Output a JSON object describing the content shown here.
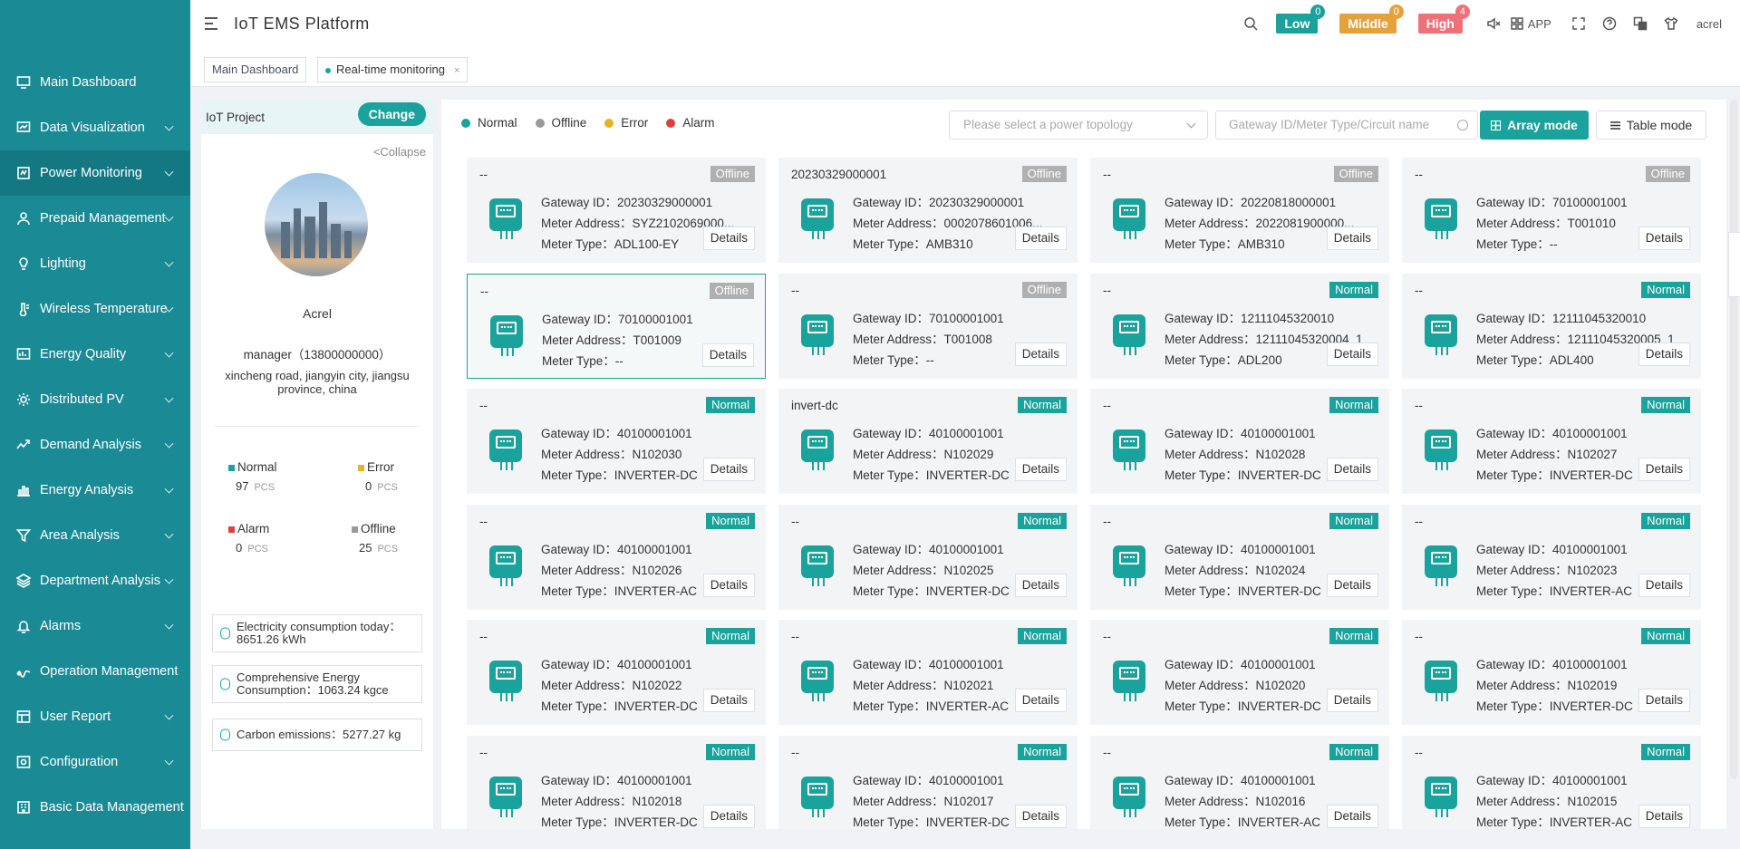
{
  "header": {
    "title": "IoT EMS Platform",
    "alerts": [
      {
        "label": "Low",
        "count": "0",
        "color": "#1aa39c",
        "badge_color": "#1aa39c"
      },
      {
        "label": "Middle",
        "count": "0",
        "color": "#e5a23b",
        "badge_color": "#e5a23b"
      },
      {
        "label": "High",
        "count": "4",
        "color": "#f07077",
        "badge_color": "#f07077"
      }
    ],
    "app_label": "APP",
    "user": "acrel"
  },
  "tabs": [
    {
      "label": "Main Dashboard",
      "active": false
    },
    {
      "label": "Real-time monitoring",
      "active": true,
      "close": "×"
    }
  ],
  "sidebar": {
    "items": [
      {
        "label": "Main Dashboard",
        "icon": "monitor-icon",
        "chevron": false
      },
      {
        "label": "Data Visualization",
        "icon": "screen-icon",
        "chevron": true
      },
      {
        "label": "Power Monitoring",
        "icon": "power-icon",
        "chevron": true,
        "active": true
      },
      {
        "label": "Prepaid Management",
        "icon": "user-icon",
        "chevron": true
      },
      {
        "label": "Lighting",
        "icon": "bulb-icon",
        "chevron": true
      },
      {
        "label": "Wireless Temperature",
        "icon": "thermometer-icon",
        "chevron": true
      },
      {
        "label": "Energy Quality",
        "icon": "quality-icon",
        "chevron": true
      },
      {
        "label": "Distributed PV",
        "icon": "sun-icon",
        "chevron": true
      },
      {
        "label": "Demand Analysis",
        "icon": "trend-icon",
        "chevron": true
      },
      {
        "label": "Energy Analysis",
        "icon": "bar-chart-icon",
        "chevron": true
      },
      {
        "label": "Area Analysis",
        "icon": "filter-icon",
        "chevron": true
      },
      {
        "label": "Department Analysis",
        "icon": "layers-icon",
        "chevron": true
      },
      {
        "label": "Alarms",
        "icon": "bell-icon",
        "chevron": true
      },
      {
        "label": "Operation Management",
        "icon": "wave-icon",
        "chevron": false
      },
      {
        "label": "User Report",
        "icon": "report-icon",
        "chevron": true
      },
      {
        "label": "Configuration",
        "icon": "config-icon",
        "chevron": true
      },
      {
        "label": "Basic Data Management",
        "icon": "building-icon",
        "chevron": false
      }
    ]
  },
  "project": {
    "label": "IoT Project",
    "change": "Change",
    "collapse": "<Collapse",
    "name": "Acrel",
    "manager": "manager（13800000000）",
    "address": "xincheng road, jiangyin city, jiangsu province, china",
    "stats": [
      {
        "label": "Normal",
        "value": "97",
        "unit": "PCS",
        "color": "#1aa39c"
      },
      {
        "label": "Error",
        "value": "0",
        "unit": "PCS",
        "color": "#e5b323"
      },
      {
        "label": "Alarm",
        "value": "0",
        "unit": "PCS",
        "color": "#e23c3c"
      },
      {
        "label": "Offline",
        "value": "25",
        "unit": "PCS",
        "color": "#9a9a9a"
      }
    ],
    "info": [
      {
        "line1": "Electricity consumption today：",
        "line2": "8651.26 kWh"
      },
      {
        "line1": "Comprehensive Energy",
        "line2": "Consumption：1063.24 kgce"
      },
      {
        "line1": "Carbon emissions：5277.27 kg",
        "line2": ""
      }
    ]
  },
  "legend": [
    {
      "label": "Normal",
      "color": "#1aa39c"
    },
    {
      "label": "Offline",
      "color": "#9a9a9a"
    },
    {
      "label": "Error",
      "color": "#e5b323"
    },
    {
      "label": "Alarm",
      "color": "#e23c3c"
    }
  ],
  "filters": {
    "topology_placeholder": "Please select a power topology",
    "search_placeholder": "Gateway ID/Meter Type/Circuit name",
    "array_mode": "Array mode",
    "table_mode": "Table mode"
  },
  "status_colors": {
    "Offline": "#b0b0b0",
    "Normal": "#1aa39c"
  },
  "card_labels": {
    "gateway": "Gateway ID：",
    "address": "Meter Address：",
    "type": "Meter Type：",
    "details": "Details"
  },
  "cards": [
    {
      "name": "--",
      "status": "Offline",
      "gateway": "20230329000001",
      "address": "SYZ2102069000...",
      "type": "ADL100-EY"
    },
    {
      "name": "20230329000001",
      "status": "Offline",
      "gateway": "20230329000001",
      "address": "0002078601006...",
      "type": "AMB310"
    },
    {
      "name": "--",
      "status": "Offline",
      "gateway": "20220818000001",
      "address": "2022081900000...",
      "type": "AMB310"
    },
    {
      "name": "--",
      "status": "Offline",
      "gateway": "70100001001",
      "address": "T001010",
      "type": "--"
    },
    {
      "name": "--",
      "status": "Offline",
      "gateway": "70100001001",
      "address": "T001009",
      "type": "--",
      "selected": true
    },
    {
      "name": "--",
      "status": "Offline",
      "gateway": "70100001001",
      "address": "T001008",
      "type": "--"
    },
    {
      "name": "--",
      "status": "Normal",
      "gateway": "12111045320010",
      "address": "12111045320004_1",
      "type": "ADL200"
    },
    {
      "name": "--",
      "status": "Normal",
      "gateway": "12111045320010",
      "address": "12111045320005_1",
      "type": "ADL400"
    },
    {
      "name": "--",
      "status": "Normal",
      "gateway": "40100001001",
      "address": "N102030",
      "type": "INVERTER-DC"
    },
    {
      "name": "invert-dc",
      "status": "Normal",
      "gateway": "40100001001",
      "address": "N102029",
      "type": "INVERTER-DC"
    },
    {
      "name": "--",
      "status": "Normal",
      "gateway": "40100001001",
      "address": "N102028",
      "type": "INVERTER-DC"
    },
    {
      "name": "--",
      "status": "Normal",
      "gateway": "40100001001",
      "address": "N102027",
      "type": "INVERTER-DC"
    },
    {
      "name": "--",
      "status": "Normal",
      "gateway": "40100001001",
      "address": "N102026",
      "type": "INVERTER-AC"
    },
    {
      "name": "--",
      "status": "Normal",
      "gateway": "40100001001",
      "address": "N102025",
      "type": "INVERTER-DC"
    },
    {
      "name": "--",
      "status": "Normal",
      "gateway": "40100001001",
      "address": "N102024",
      "type": "INVERTER-DC"
    },
    {
      "name": "--",
      "status": "Normal",
      "gateway": "40100001001",
      "address": "N102023",
      "type": "INVERTER-AC"
    },
    {
      "name": "--",
      "status": "Normal",
      "gateway": "40100001001",
      "address": "N102022",
      "type": "INVERTER-DC"
    },
    {
      "name": "--",
      "status": "Normal",
      "gateway": "40100001001",
      "address": "N102021",
      "type": "INVERTER-AC"
    },
    {
      "name": "--",
      "status": "Normal",
      "gateway": "40100001001",
      "address": "N102020",
      "type": "INVERTER-DC"
    },
    {
      "name": "--",
      "status": "Normal",
      "gateway": "40100001001",
      "address": "N102019",
      "type": "INVERTER-DC"
    },
    {
      "name": "--",
      "status": "Normal",
      "gateway": "40100001001",
      "address": "N102018",
      "type": "INVERTER-DC"
    },
    {
      "name": "--",
      "status": "Normal",
      "gateway": "40100001001",
      "address": "N102017",
      "type": "INVERTER-DC"
    },
    {
      "name": "--",
      "status": "Normal",
      "gateway": "40100001001",
      "address": "N102016",
      "type": "INVERTER-AC"
    },
    {
      "name": "--",
      "status": "Normal",
      "gateway": "40100001001",
      "address": "N102015",
      "type": "INVERTER-AC"
    }
  ]
}
